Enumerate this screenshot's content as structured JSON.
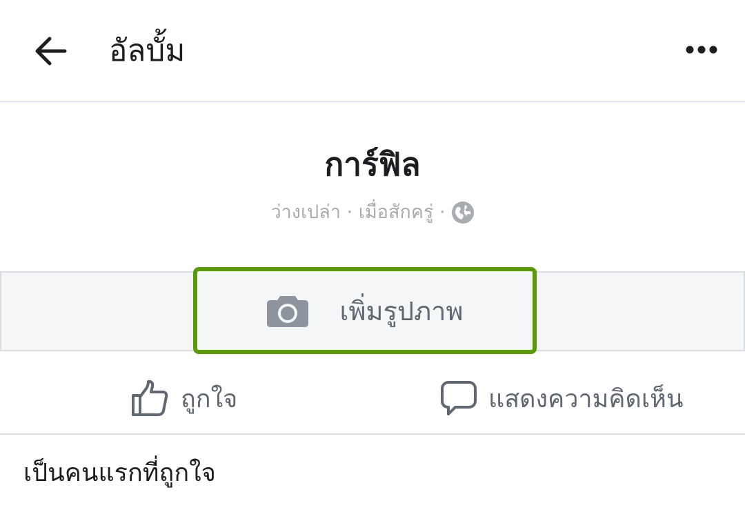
{
  "header": {
    "title": "อัลบั้ม",
    "back_icon": "arrow-left-icon",
    "more_icon": "more-dots-icon"
  },
  "album": {
    "name": "การ์ฟิล",
    "meta_text": "ว่างเปล่า · เมื่อสักครู่ ·",
    "privacy_icon": "globe-icon"
  },
  "add_photo": {
    "label": "เพิ่มรูปภาพ",
    "icon": "camera-icon",
    "highlight_color": "#5a9a08"
  },
  "actions": {
    "like_label": "ถูกใจ",
    "comment_label": "แสดงความคิดเห็น"
  },
  "footer": {
    "first_like_text": "เป็นคนแรกที่ถูกใจ"
  },
  "colors": {
    "muted_text": "#606770",
    "meta_text": "#a8abaf",
    "divider": "#dadde1",
    "strip_bg": "#f5f6f7"
  }
}
